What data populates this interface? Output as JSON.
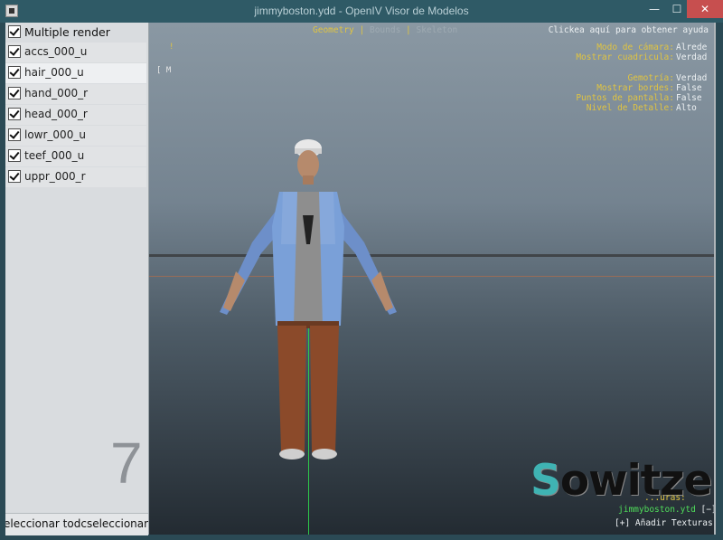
{
  "window": {
    "title": "jimmyboston.ydd - OpenIV Visor de Modelos",
    "minimize_glyph": "—",
    "maximize_glyph": "☐",
    "close_glyph": "✕"
  },
  "left_panel": {
    "multiple_render": {
      "label": "Multiple render",
      "checked": true
    },
    "items": [
      {
        "label": "accs_000_u",
        "checked": true,
        "selected": false
      },
      {
        "label": "hair_000_u",
        "checked": true,
        "selected": true
      },
      {
        "label": "hand_000_r",
        "checked": true,
        "selected": false
      },
      {
        "label": "head_000_r",
        "checked": true,
        "selected": false
      },
      {
        "label": "lowr_000_u",
        "checked": true,
        "selected": false
      },
      {
        "label": "teef_000_u",
        "checked": true,
        "selected": false
      },
      {
        "label": "uppr_000_r",
        "checked": true,
        "selected": false
      }
    ],
    "item_count": "7",
    "bottom_buttons": [
      "eleccionar tod",
      "cseleccionar tod"
    ]
  },
  "viewport": {
    "tabs": [
      {
        "label": "Geometry",
        "active": true
      },
      {
        "label": "Bounds",
        "active": false
      },
      {
        "label": "Skeleton",
        "active": false
      }
    ],
    "tab_separator": "|",
    "help_link": "Clickea aquí para obtener ayuda",
    "axis_marker": "!",
    "m_marker": "[ M",
    "info_group1": [
      {
        "key": "Modo de cámara:",
        "value": "Alrede"
      },
      {
        "key": "Mostrar cuadricula:",
        "value": "Verdad"
      }
    ],
    "info_group2": [
      {
        "key": "Gemotría:",
        "value": "Verdad"
      },
      {
        "key": "Mostrar bordes:",
        "value": "False"
      },
      {
        "key": "Puntos de pantalla:",
        "value": "False"
      },
      {
        "key": "Nivel de Detalle:",
        "value": "Alto"
      }
    ],
    "textures": {
      "header": "...uras:",
      "file": "jimmyboston.ytd",
      "remove": "[−]",
      "add": "[+] Añadir Texturas"
    },
    "watermark": {
      "first": "S",
      "rest": "owitzer"
    },
    "colors": {
      "info_key": "#e0c441",
      "info_value": "#eef2f4",
      "texture_file": "#4fdc5a",
      "close_button": "#c74f4f"
    }
  }
}
